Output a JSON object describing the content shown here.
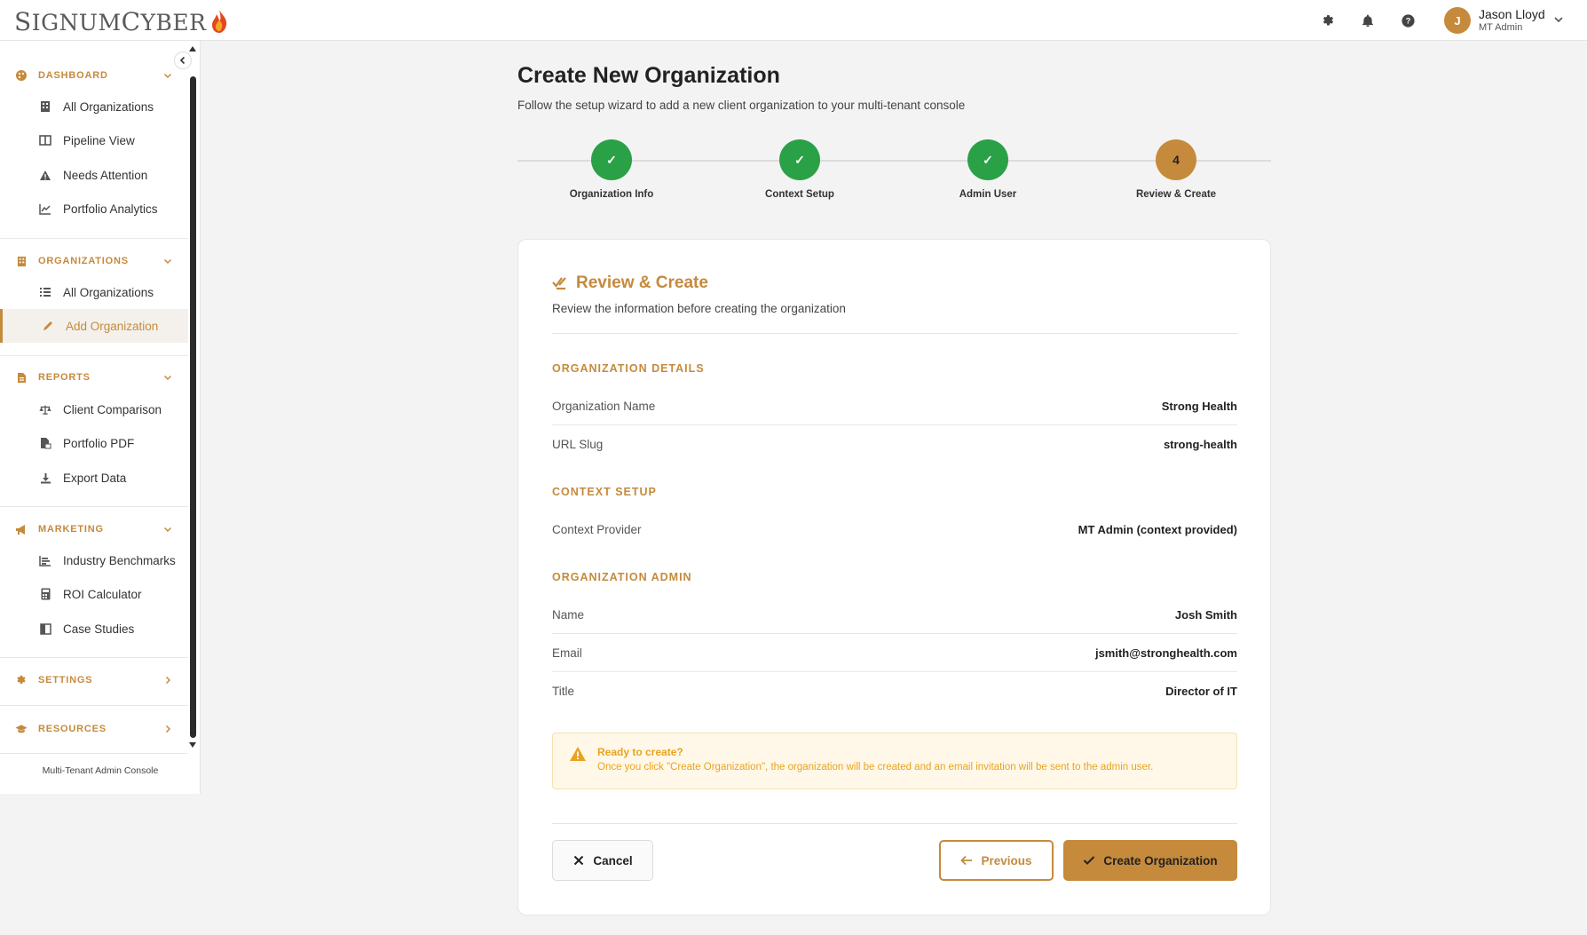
{
  "brand": {
    "name_first": "S",
    "name_rest1": "IGNUM",
    "name_c": "C",
    "name_rest2": "YBER",
    "accent": "#c58a3c"
  },
  "header": {
    "icons": [
      "gear-icon",
      "bell-icon",
      "help-icon"
    ],
    "user": {
      "initial": "J",
      "name": "Jason Lloyd",
      "role": "MT Admin"
    }
  },
  "sidebar": {
    "sections": [
      {
        "label": "DASHBOARD",
        "icon": "palette-icon",
        "items": [
          {
            "label": "All Organizations",
            "icon": "building-icon"
          },
          {
            "label": "Pipeline View",
            "icon": "columns-icon"
          },
          {
            "label": "Needs Attention",
            "icon": "warning-icon"
          },
          {
            "label": "Portfolio Analytics",
            "icon": "line-chart-icon"
          }
        ]
      },
      {
        "label": "ORGANIZATIONS",
        "icon": "building-icon",
        "items": [
          {
            "label": "All Organizations",
            "icon": "list-icon"
          },
          {
            "label": "Add Organization",
            "icon": "pencil-icon",
            "active": true
          }
        ]
      },
      {
        "label": "REPORTS",
        "icon": "file-icon",
        "items": [
          {
            "label": "Client Comparison",
            "icon": "scale-icon"
          },
          {
            "label": "Portfolio PDF",
            "icon": "file-pdf-icon"
          },
          {
            "label": "Export Data",
            "icon": "download-icon"
          }
        ]
      },
      {
        "label": "MARKETING",
        "icon": "megaphone-icon",
        "items": [
          {
            "label": "Industry Benchmarks",
            "icon": "bar-chart-icon"
          },
          {
            "label": "ROI Calculator",
            "icon": "calculator-icon"
          },
          {
            "label": "Case Studies",
            "icon": "book-icon"
          }
        ]
      },
      {
        "label": "SETTINGS",
        "icon": "gear-icon",
        "items": []
      },
      {
        "label": "RESOURCES",
        "icon": "graduation-cap-icon",
        "items": []
      }
    ],
    "footer": "Multi-Tenant Admin Console"
  },
  "page": {
    "title": "Create New Organization",
    "subtitle": "Follow the setup wizard to add a new client organization to your multi-tenant console"
  },
  "stepper": {
    "steps": [
      {
        "label": "Organization Info",
        "state": "done",
        "mark": "✓"
      },
      {
        "label": "Context Setup",
        "state": "done",
        "mark": "✓"
      },
      {
        "label": "Admin User",
        "state": "done",
        "mark": "✓"
      },
      {
        "label": "Review & Create",
        "state": "current",
        "mark": "4"
      }
    ]
  },
  "review": {
    "title": "Review & Create",
    "subtitle": "Review the information before creating the organization",
    "groups": {
      "org_details": {
        "title": "ORGANIZATION DETAILS",
        "rows": [
          {
            "key": "Organization Name",
            "value": "Strong Health"
          },
          {
            "key": "URL Slug",
            "value": "strong-health"
          }
        ]
      },
      "context": {
        "title": "CONTEXT SETUP",
        "rows": [
          {
            "key": "Context Provider",
            "value": "MT Admin (context provided)"
          }
        ]
      },
      "admin": {
        "title": "ORGANIZATION ADMIN",
        "rows": [
          {
            "key": "Name",
            "value": "Josh Smith"
          },
          {
            "key": "Email",
            "value": "jsmith@stronghealth.com"
          },
          {
            "key": "Title",
            "value": "Director of IT"
          }
        ]
      }
    },
    "notice": {
      "title": "Ready to create?",
      "text": "Once you click \"Create Organization\", the organization will be created and an email invitation will be sent to the admin user."
    },
    "buttons": {
      "cancel": "Cancel",
      "previous": "Previous",
      "create": "Create Organization"
    }
  },
  "colors": {
    "accent": "#c58a3c",
    "success": "#2aa146",
    "warning": "#e8a320"
  }
}
